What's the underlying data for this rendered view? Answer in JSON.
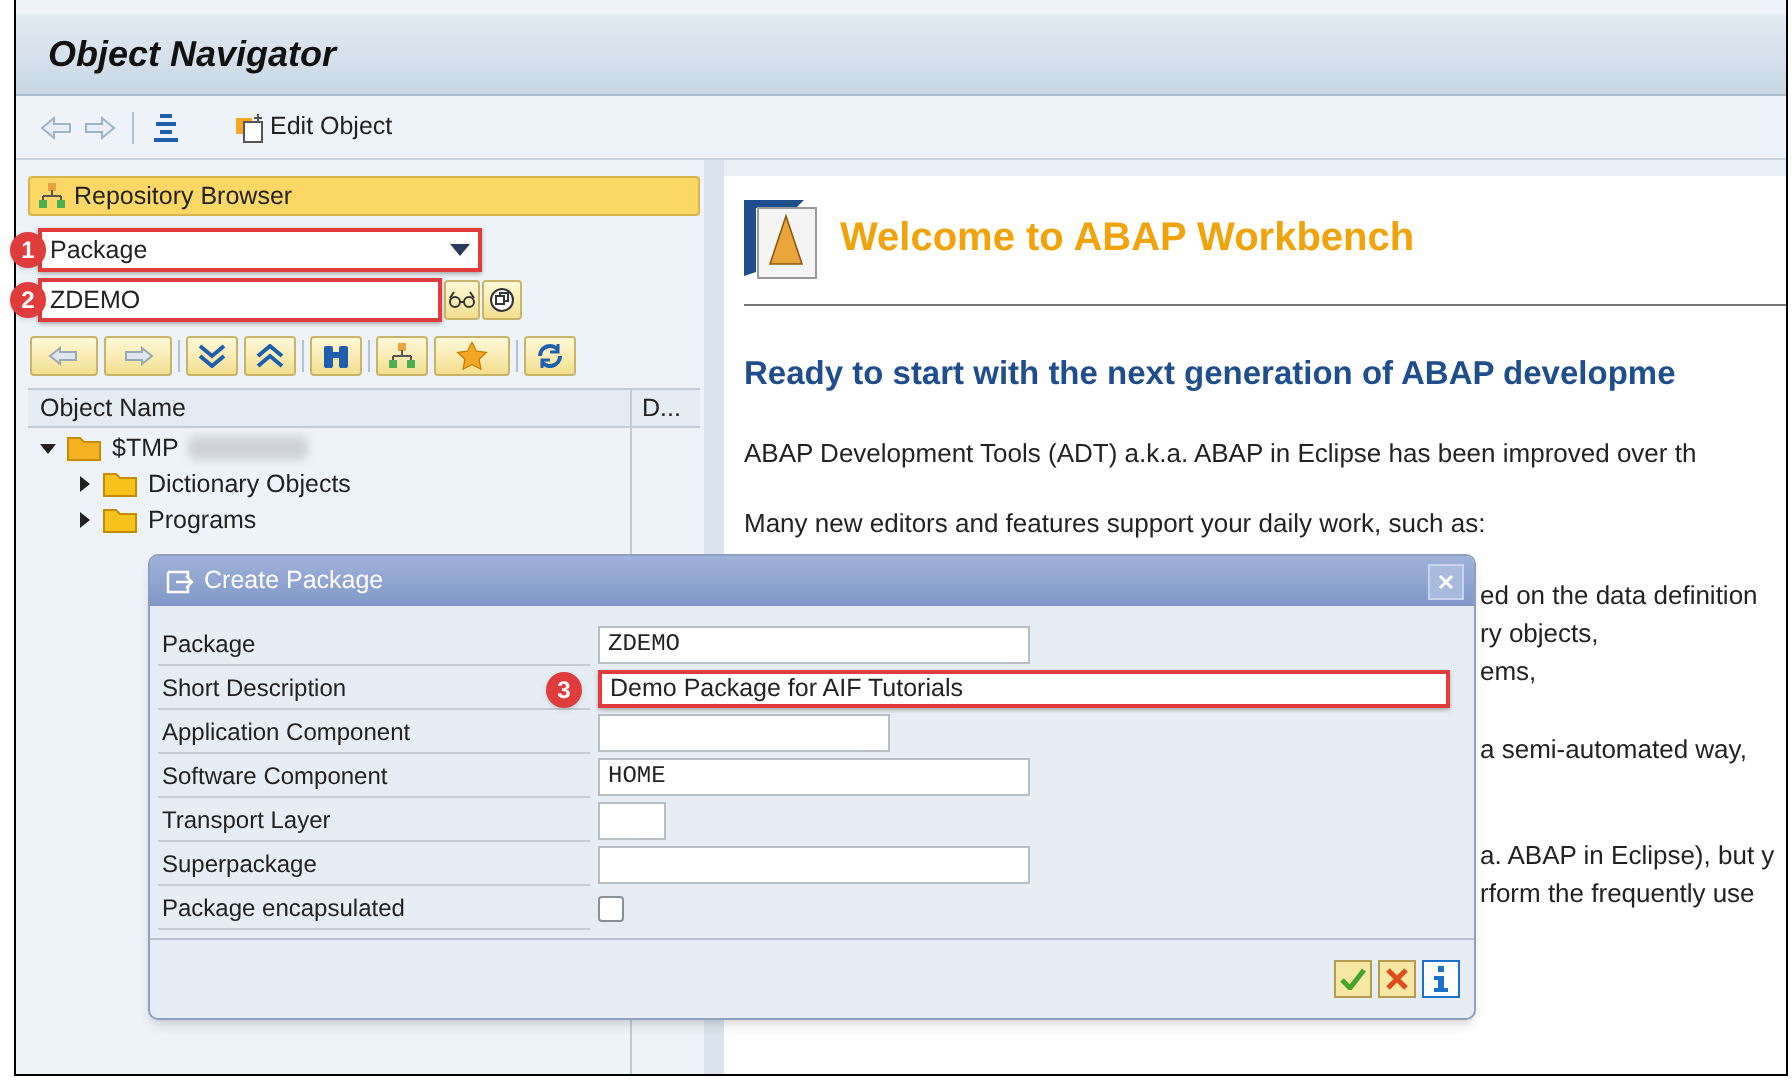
{
  "window": {
    "title": "Object Navigator"
  },
  "toolbar": {
    "edit_button": "Edit Object"
  },
  "browser": {
    "title": "Repository Browser",
    "object_type": {
      "value": "Package",
      "marker": "1"
    },
    "object_name": {
      "value": "ZDEMO",
      "marker": "2"
    }
  },
  "tree": {
    "columns": [
      "Object Name",
      "D..."
    ],
    "nodes": [
      {
        "label": "$TMP",
        "expanded": true,
        "children": [
          {
            "label": "Dictionary Objects",
            "expanded": false
          },
          {
            "label": "Programs",
            "expanded": false
          }
        ]
      }
    ]
  },
  "welcome": {
    "title": "Welcome to ABAP Workbench",
    "heading": "Ready to start with the next generation of ABAP developme",
    "paragraphs": [
      "ABAP Development Tools (ADT) a.k.a. ABAP in Eclipse has been improved over th",
      "Many new editors and features support your daily work, such as:"
    ],
    "partial_lines": [
      "ed on the data definition",
      "ry objects,",
      "ems,",
      "a semi-automated way,",
      "a. ABAP in Eclipse), but y",
      "rform the frequently use"
    ]
  },
  "dialog": {
    "title": "Create Package",
    "fields": [
      {
        "label": "Package",
        "kind": "code",
        "value": "ZDEMO"
      },
      {
        "label": "Short Description",
        "kind": "text",
        "value": "Demo Package for AIF Tutorials",
        "marker": "3"
      },
      {
        "label": "Application Component",
        "kind": "code"
      },
      {
        "label": "Software Component",
        "kind": "code",
        "value": "HOME"
      },
      {
        "label": "Transport Layer",
        "kind": "code"
      },
      {
        "label": "Superpackage",
        "kind": "code"
      },
      {
        "label": "Package encapsulated",
        "kind": "checkbox",
        "checked": false
      }
    ]
  }
}
